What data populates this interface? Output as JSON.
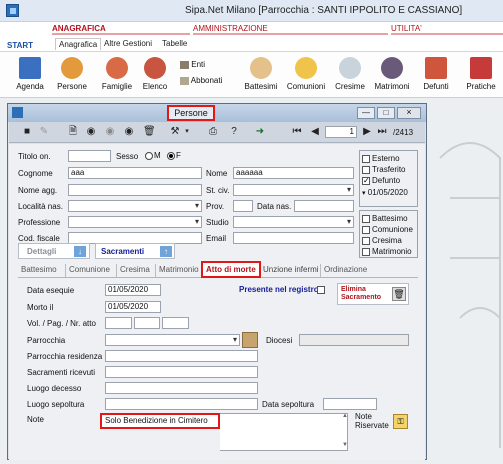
{
  "window": {
    "title": "Sipa.Net Milano  [Parrocchia : SANTI IPPOLITO E CASSIANO]"
  },
  "ribbon": {
    "categories": {
      "anagrafica": "ANAGRAFICA",
      "amministrazione": "AMMINISTRAZIONE",
      "utilita": "UTILITA'"
    },
    "tabs": {
      "start": "START",
      "anagrafica": "Anagrafica",
      "altre": "Altre Gestioni",
      "tabelle": "Tabelle"
    },
    "buttons": {
      "agenda": "Agenda",
      "persone": "Persone",
      "famiglie": "Famiglie",
      "elenco": "Elenco",
      "enti": "Enti",
      "abbonati": "Abbonati",
      "battesimi": "Battesimi",
      "comunioni": "Comunioni",
      "cresime": "Cresime",
      "matrimoni": "Matrimoni",
      "defunti": "Defunti",
      "pratiche": "Pratiche"
    }
  },
  "child": {
    "title": "Persone",
    "nav": {
      "record": "1",
      "total": "/2413"
    }
  },
  "form": {
    "titolo_label": "Titolo on.",
    "titolo_value": "",
    "sesso_label": "Sesso",
    "sesso_m": "M",
    "sesso_f": "F",
    "cognome_label": "Cognome",
    "cognome_value": "aaa",
    "nome_label": "Nome",
    "nome_value": "aaaaaa",
    "nome_agg_label": "Nome agg.",
    "stciv_label": "St. civ.",
    "localita_label": "Località nas.",
    "prov_label": "Prov.",
    "datanas_label": "Data nas.",
    "professione_label": "Professione",
    "studio_label": "Studio",
    "codfisc_label": "Cod. fiscale",
    "email_label": "Email",
    "status": {
      "esterno": "Esterno",
      "trasferito": "Trasferito",
      "defunto": "Defunto",
      "defunto_date": "01/05/2020"
    },
    "sacraments": {
      "battesimo": "Battesimo",
      "comunione": "Comunione",
      "cresima": "Cresima",
      "matrimonio": "Matrimonio"
    },
    "dettagli_btn": "Dettagli",
    "sacramenti_btn": "Sacramenti"
  },
  "tabs": {
    "battesimo": "Battesimo",
    "comunione": "Comunione",
    "cresima": "Cresima",
    "matrimonio": "Matrimonio",
    "atto_di_morte": "Atto di morte",
    "unzione": "Unzione infermi",
    "ordinazione": "Ordinazione"
  },
  "death": {
    "data_esequie_label": "Data esequie",
    "data_esequie": "01/05/2020",
    "morto_il_label": "Morto il",
    "morto_il": "01/05/2020",
    "vol_label": "Vol. / Pag. / Nr. atto",
    "parrocchia_label": "Parrocchia",
    "diocesi_label": "Diocesi",
    "parrocchia_res_label": "Parrocchia residenza",
    "sacramenti_ric_label": "Sacramenti ricevuti",
    "luogo_decesso_label": "Luogo decesso",
    "luogo_sepoltura_label": "Luogo sepoltura",
    "data_sepoltura_label": "Data sepoltura",
    "note_label": "Note",
    "note_value": "Solo Benedizione in Cimitero",
    "note_riservate_label": "Note\nRiservate",
    "presente_registro": "Presente nel registro",
    "elimina_sacramento": "Elimina\nSacramento"
  },
  "colors": {
    "accent_red": "#e21818",
    "brand_blue": "#1a4f9c",
    "sacramenti_blue": "#16209a"
  }
}
